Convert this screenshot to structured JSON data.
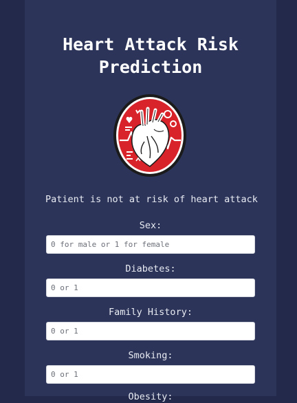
{
  "title": "Heart Attack Risk Prediction",
  "logo": {
    "icon": "heart-ekg-logo-icon",
    "colors": {
      "ring": "#1b1b1b",
      "disc": "#d8232a",
      "heart": "#ffffff"
    }
  },
  "result": "Patient is not at risk of heart attack",
  "fields": [
    {
      "label": "Sex:",
      "placeholder": "0 for male or 1 for female"
    },
    {
      "label": "Diabetes:",
      "placeholder": "0 or 1"
    },
    {
      "label": "Family History:",
      "placeholder": "0 or 1"
    },
    {
      "label": "Smoking:",
      "placeholder": "0 or 1"
    },
    {
      "label": "Obesity:"
    }
  ],
  "colors": {
    "background": "#23294a",
    "panel": "#2c3559",
    "text": "#e9ebf3"
  }
}
